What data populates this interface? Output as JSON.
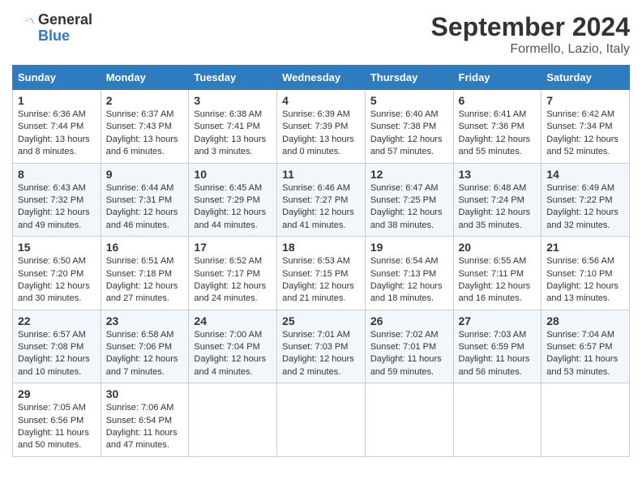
{
  "header": {
    "logo_line1": "General",
    "logo_line2": "Blue",
    "title": "September 2024",
    "subtitle": "Formello, Lazio, Italy"
  },
  "columns": [
    "Sunday",
    "Monday",
    "Tuesday",
    "Wednesday",
    "Thursday",
    "Friday",
    "Saturday"
  ],
  "weeks": [
    [
      {
        "day": "1",
        "sunrise": "Sunrise: 6:36 AM",
        "sunset": "Sunset: 7:44 PM",
        "daylight": "Daylight: 13 hours and 8 minutes."
      },
      {
        "day": "2",
        "sunrise": "Sunrise: 6:37 AM",
        "sunset": "Sunset: 7:43 PM",
        "daylight": "Daylight: 13 hours and 6 minutes."
      },
      {
        "day": "3",
        "sunrise": "Sunrise: 6:38 AM",
        "sunset": "Sunset: 7:41 PM",
        "daylight": "Daylight: 13 hours and 3 minutes."
      },
      {
        "day": "4",
        "sunrise": "Sunrise: 6:39 AM",
        "sunset": "Sunset: 7:39 PM",
        "daylight": "Daylight: 13 hours and 0 minutes."
      },
      {
        "day": "5",
        "sunrise": "Sunrise: 6:40 AM",
        "sunset": "Sunset: 7:38 PM",
        "daylight": "Daylight: 12 hours and 57 minutes."
      },
      {
        "day": "6",
        "sunrise": "Sunrise: 6:41 AM",
        "sunset": "Sunset: 7:36 PM",
        "daylight": "Daylight: 12 hours and 55 minutes."
      },
      {
        "day": "7",
        "sunrise": "Sunrise: 6:42 AM",
        "sunset": "Sunset: 7:34 PM",
        "daylight": "Daylight: 12 hours and 52 minutes."
      }
    ],
    [
      {
        "day": "8",
        "sunrise": "Sunrise: 6:43 AM",
        "sunset": "Sunset: 7:32 PM",
        "daylight": "Daylight: 12 hours and 49 minutes."
      },
      {
        "day": "9",
        "sunrise": "Sunrise: 6:44 AM",
        "sunset": "Sunset: 7:31 PM",
        "daylight": "Daylight: 12 hours and 46 minutes."
      },
      {
        "day": "10",
        "sunrise": "Sunrise: 6:45 AM",
        "sunset": "Sunset: 7:29 PM",
        "daylight": "Daylight: 12 hours and 44 minutes."
      },
      {
        "day": "11",
        "sunrise": "Sunrise: 6:46 AM",
        "sunset": "Sunset: 7:27 PM",
        "daylight": "Daylight: 12 hours and 41 minutes."
      },
      {
        "day": "12",
        "sunrise": "Sunrise: 6:47 AM",
        "sunset": "Sunset: 7:25 PM",
        "daylight": "Daylight: 12 hours and 38 minutes."
      },
      {
        "day": "13",
        "sunrise": "Sunrise: 6:48 AM",
        "sunset": "Sunset: 7:24 PM",
        "daylight": "Daylight: 12 hours and 35 minutes."
      },
      {
        "day": "14",
        "sunrise": "Sunrise: 6:49 AM",
        "sunset": "Sunset: 7:22 PM",
        "daylight": "Daylight: 12 hours and 32 minutes."
      }
    ],
    [
      {
        "day": "15",
        "sunrise": "Sunrise: 6:50 AM",
        "sunset": "Sunset: 7:20 PM",
        "daylight": "Daylight: 12 hours and 30 minutes."
      },
      {
        "day": "16",
        "sunrise": "Sunrise: 6:51 AM",
        "sunset": "Sunset: 7:18 PM",
        "daylight": "Daylight: 12 hours and 27 minutes."
      },
      {
        "day": "17",
        "sunrise": "Sunrise: 6:52 AM",
        "sunset": "Sunset: 7:17 PM",
        "daylight": "Daylight: 12 hours and 24 minutes."
      },
      {
        "day": "18",
        "sunrise": "Sunrise: 6:53 AM",
        "sunset": "Sunset: 7:15 PM",
        "daylight": "Daylight: 12 hours and 21 minutes."
      },
      {
        "day": "19",
        "sunrise": "Sunrise: 6:54 AM",
        "sunset": "Sunset: 7:13 PM",
        "daylight": "Daylight: 12 hours and 18 minutes."
      },
      {
        "day": "20",
        "sunrise": "Sunrise: 6:55 AM",
        "sunset": "Sunset: 7:11 PM",
        "daylight": "Daylight: 12 hours and 16 minutes."
      },
      {
        "day": "21",
        "sunrise": "Sunrise: 6:56 AM",
        "sunset": "Sunset: 7:10 PM",
        "daylight": "Daylight: 12 hours and 13 minutes."
      }
    ],
    [
      {
        "day": "22",
        "sunrise": "Sunrise: 6:57 AM",
        "sunset": "Sunset: 7:08 PM",
        "daylight": "Daylight: 12 hours and 10 minutes."
      },
      {
        "day": "23",
        "sunrise": "Sunrise: 6:58 AM",
        "sunset": "Sunset: 7:06 PM",
        "daylight": "Daylight: 12 hours and 7 minutes."
      },
      {
        "day": "24",
        "sunrise": "Sunrise: 7:00 AM",
        "sunset": "Sunset: 7:04 PM",
        "daylight": "Daylight: 12 hours and 4 minutes."
      },
      {
        "day": "25",
        "sunrise": "Sunrise: 7:01 AM",
        "sunset": "Sunset: 7:03 PM",
        "daylight": "Daylight: 12 hours and 2 minutes."
      },
      {
        "day": "26",
        "sunrise": "Sunrise: 7:02 AM",
        "sunset": "Sunset: 7:01 PM",
        "daylight": "Daylight: 11 hours and 59 minutes."
      },
      {
        "day": "27",
        "sunrise": "Sunrise: 7:03 AM",
        "sunset": "Sunset: 6:59 PM",
        "daylight": "Daylight: 11 hours and 56 minutes."
      },
      {
        "day": "28",
        "sunrise": "Sunrise: 7:04 AM",
        "sunset": "Sunset: 6:57 PM",
        "daylight": "Daylight: 11 hours and 53 minutes."
      }
    ],
    [
      {
        "day": "29",
        "sunrise": "Sunrise: 7:05 AM",
        "sunset": "Sunset: 6:56 PM",
        "daylight": "Daylight: 11 hours and 50 minutes."
      },
      {
        "day": "30",
        "sunrise": "Sunrise: 7:06 AM",
        "sunset": "Sunset: 6:54 PM",
        "daylight": "Daylight: 11 hours and 47 minutes."
      },
      null,
      null,
      null,
      null,
      null
    ]
  ]
}
